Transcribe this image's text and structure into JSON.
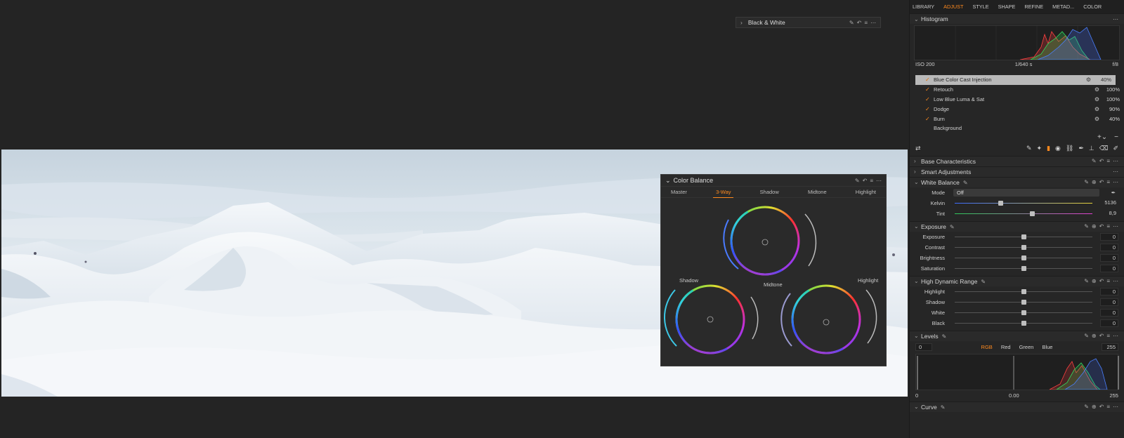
{
  "floating_panel": {
    "title": "Black & White"
  },
  "color_balance": {
    "title": "Color Balance",
    "tabs": [
      "Master",
      "3-Way",
      "Shadow",
      "Midtone",
      "Highlight"
    ],
    "active_tab": "3-Way",
    "labels": {
      "shadow": "Shadow",
      "midtone": "Midtone",
      "highlight": "Highlight"
    }
  },
  "nav": {
    "items": [
      "LIBRARY",
      "ADJUST",
      "STYLE",
      "SHAPE",
      "REFINE",
      "METAD...",
      "COLOR"
    ],
    "active": "ADJUST"
  },
  "histogram": {
    "title": "Histogram",
    "iso": "ISO 200",
    "shutter": "1/640 s",
    "aperture": "f/8"
  },
  "layers": [
    {
      "name": "Blue Color Cast Injection",
      "checked": true,
      "pct": "40%",
      "selected": true
    },
    {
      "name": "Retouch",
      "checked": true,
      "pct": "100%"
    },
    {
      "name": "Low Blue Luma & Sat",
      "checked": true,
      "pct": "100%"
    },
    {
      "name": "Dodge",
      "checked": true,
      "pct": "90%"
    },
    {
      "name": "Burn",
      "checked": true,
      "pct": "40%"
    },
    {
      "name": "Background",
      "checked": false,
      "pct": ""
    }
  ],
  "sections": {
    "base": "Base Characteristics",
    "smart": "Smart Adjustments",
    "wb": "White Balance",
    "exposure": "Exposure",
    "hdr": "High Dynamic Range",
    "levels": "Levels",
    "curve": "Curve"
  },
  "white_balance": {
    "mode_label": "Mode",
    "mode_value": "Off",
    "kelvin_label": "Kelvin",
    "kelvin_value": "5136",
    "kelvin_pos": 0.33,
    "tint_label": "Tint",
    "tint_value": "8,9",
    "tint_pos": 0.56
  },
  "exposure": [
    {
      "label": "Exposure",
      "value": "0",
      "pos": 0.5
    },
    {
      "label": "Contrast",
      "value": "0",
      "pos": 0.5
    },
    {
      "label": "Brightness",
      "value": "0",
      "pos": 0.5
    },
    {
      "label": "Saturation",
      "value": "0",
      "pos": 0.5
    }
  ],
  "hdr": [
    {
      "label": "Highlight",
      "value": "0",
      "pos": 0.5
    },
    {
      "label": "Shadow",
      "value": "0",
      "pos": 0.5
    },
    {
      "label": "White",
      "value": "0",
      "pos": 0.5
    },
    {
      "label": "Black",
      "value": "0",
      "pos": 0.5
    }
  ],
  "levels": {
    "tabs": [
      "RGB",
      "Red",
      "Green",
      "Blue"
    ],
    "active": "RGB",
    "in_low": "0",
    "in_high": "255",
    "out_low": "0",
    "mid": "0.00",
    "out_high": "255"
  },
  "colors": {
    "accent": "#ff8a1e",
    "panel": "#2a2a2a",
    "background": "#242424"
  }
}
